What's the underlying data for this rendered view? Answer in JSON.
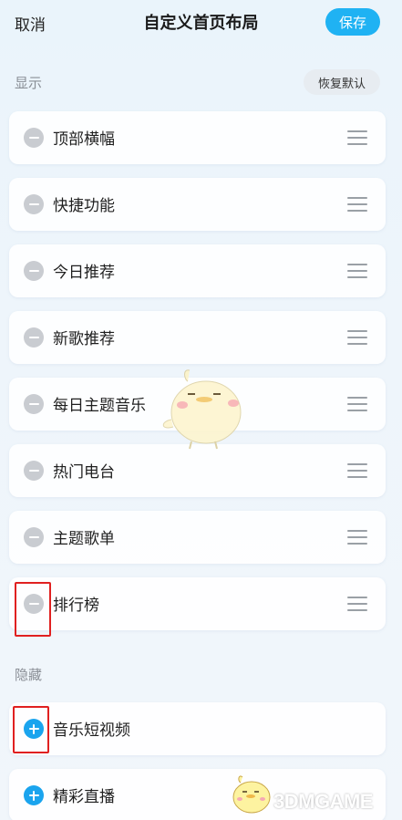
{
  "header": {
    "cancel_label": "取消",
    "title": "自定义首页布局",
    "save_label": "保存"
  },
  "shown_section": {
    "label": "显示",
    "restore_label": "恢复默认",
    "items": [
      {
        "label": "顶部横幅"
      },
      {
        "label": "快捷功能"
      },
      {
        "label": "今日推荐"
      },
      {
        "label": "新歌推荐"
      },
      {
        "label": "每日主题音乐"
      },
      {
        "label": "热门电台"
      },
      {
        "label": "主题歌单"
      },
      {
        "label": "排行榜"
      }
    ]
  },
  "hidden_section": {
    "label": "隐藏",
    "items": [
      {
        "label": "音乐短视频"
      },
      {
        "label": "精彩直播"
      }
    ]
  },
  "watermark": {
    "text": "3DMGAME"
  },
  "colors": {
    "accent": "#1fb2f3",
    "plus": "#1aa4ee",
    "minus": "#c9ccd1",
    "highlight": "#e02020"
  }
}
